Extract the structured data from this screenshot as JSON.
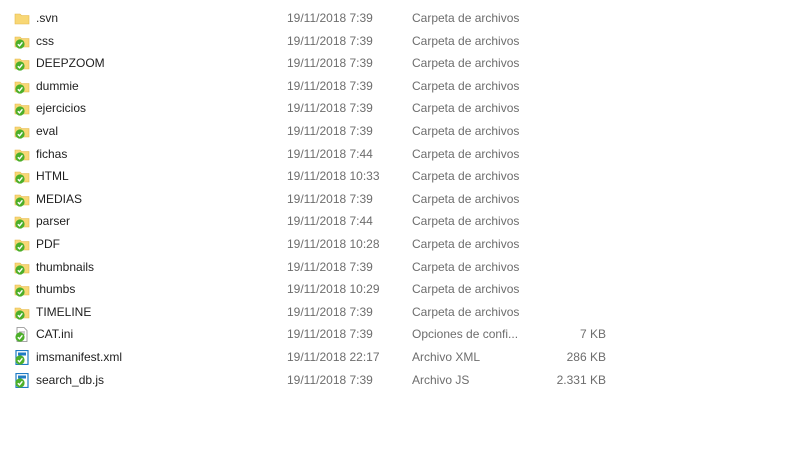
{
  "files": [
    {
      "name": ".svn",
      "date": "19/11/2018 7:39",
      "type": "Carpeta de archivos",
      "size": "",
      "icon": "folder-icon"
    },
    {
      "name": "css",
      "date": "19/11/2018 7:39",
      "type": "Carpeta de archivos",
      "size": "",
      "icon": "folder-synced-icon"
    },
    {
      "name": "DEEPZOOM",
      "date": "19/11/2018 7:39",
      "type": "Carpeta de archivos",
      "size": "",
      "icon": "folder-synced-icon"
    },
    {
      "name": "dummie",
      "date": "19/11/2018 7:39",
      "type": "Carpeta de archivos",
      "size": "",
      "icon": "folder-synced-icon"
    },
    {
      "name": "ejercicios",
      "date": "19/11/2018 7:39",
      "type": "Carpeta de archivos",
      "size": "",
      "icon": "folder-synced-icon"
    },
    {
      "name": "eval",
      "date": "19/11/2018 7:39",
      "type": "Carpeta de archivos",
      "size": "",
      "icon": "folder-synced-icon"
    },
    {
      "name": "fichas",
      "date": "19/11/2018 7:44",
      "type": "Carpeta de archivos",
      "size": "",
      "icon": "folder-synced-icon"
    },
    {
      "name": "HTML",
      "date": "19/11/2018 10:33",
      "type": "Carpeta de archivos",
      "size": "",
      "icon": "folder-synced-icon"
    },
    {
      "name": "MEDIAS",
      "date": "19/11/2018 7:39",
      "type": "Carpeta de archivos",
      "size": "",
      "icon": "folder-synced-icon"
    },
    {
      "name": "parser",
      "date": "19/11/2018 7:44",
      "type": "Carpeta de archivos",
      "size": "",
      "icon": "folder-synced-icon"
    },
    {
      "name": "PDF",
      "date": "19/11/2018 10:28",
      "type": "Carpeta de archivos",
      "size": "",
      "icon": "folder-synced-icon"
    },
    {
      "name": "thumbnails",
      "date": "19/11/2018 7:39",
      "type": "Carpeta de archivos",
      "size": "",
      "icon": "folder-synced-icon"
    },
    {
      "name": "thumbs",
      "date": "19/11/2018 10:29",
      "type": "Carpeta de archivos",
      "size": "",
      "icon": "folder-synced-icon"
    },
    {
      "name": "TIMELINE",
      "date": "19/11/2018 7:39",
      "type": "Carpeta de archivos",
      "size": "",
      "icon": "folder-synced-icon"
    },
    {
      "name": "CAT.ini",
      "date": "19/11/2018 7:39",
      "type": "Opciones de confi...",
      "size": "7 KB",
      "icon": "ini-file-synced-icon"
    },
    {
      "name": "imsmanifest.xml",
      "date": "19/11/2018 22:17",
      "type": "Archivo XML",
      "size": "286 KB",
      "icon": "xml-file-synced-icon"
    },
    {
      "name": "search_db.js",
      "date": "19/11/2018 7:39",
      "type": "Archivo JS",
      "size": "2.331 KB",
      "icon": "js-file-synced-icon"
    }
  ],
  "colors": {
    "folder": "#f8d775",
    "folder_dark": "#e4b84a",
    "sync_green": "#4caf2a",
    "file_blue": "#1f7bc4"
  }
}
